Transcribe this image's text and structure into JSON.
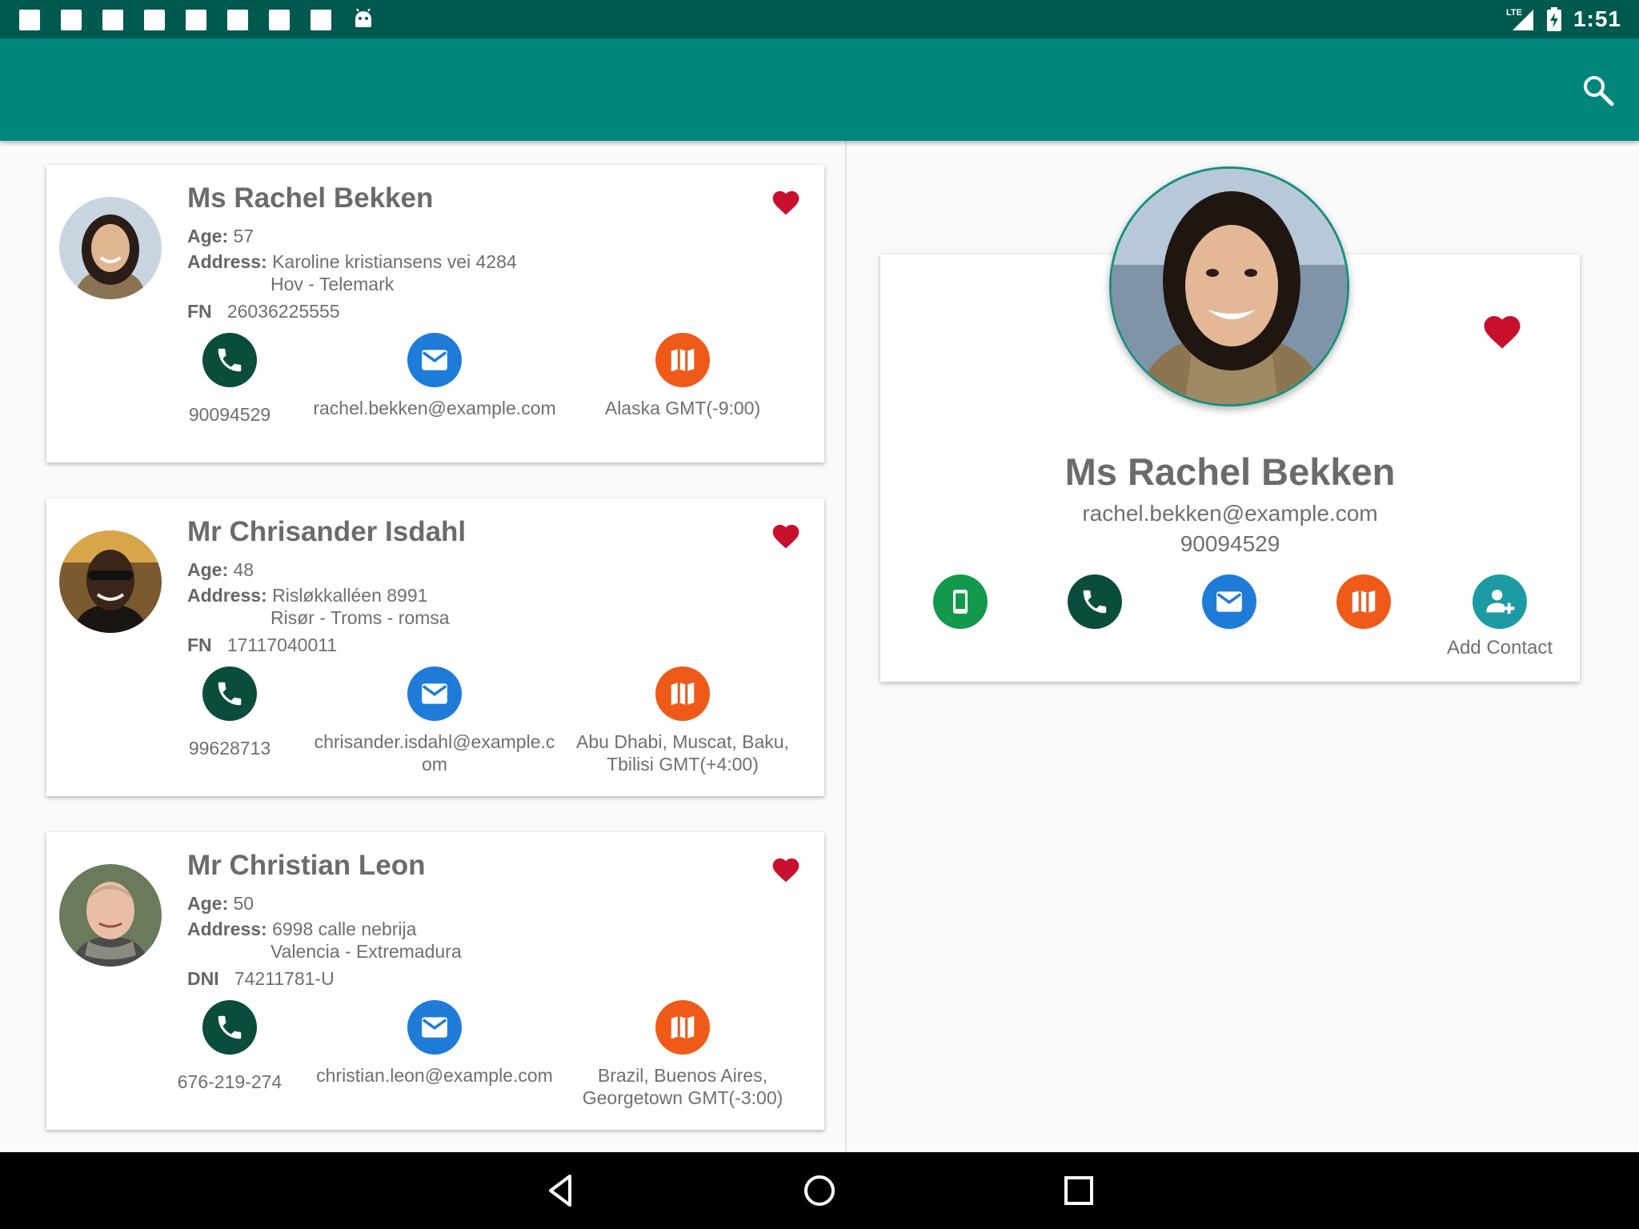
{
  "status_bar": {
    "time": "1:51",
    "network": "LTE",
    "notification_icons": [
      "square-notification-icon",
      "square-notification-icon",
      "square-notification-icon",
      "square-notification-icon",
      "square-notification-icon",
      "square-notification-icon",
      "square-notification-icon",
      "square-notification-icon",
      "android-icon"
    ]
  },
  "app_bar": {
    "color": "#00867a",
    "search_icon": "search-icon"
  },
  "contacts": [
    {
      "name": "Ms Rachel Bekken",
      "age_label": "Age:",
      "age": "57",
      "address_label": "Address:",
      "address_line1": "Karoline kristiansens vei 4284",
      "address_line2": "Hov - Telemark",
      "id_label": "FN",
      "id_value": "26036225555",
      "phone": "90094529",
      "email": "rachel.bekken@example.com",
      "timezone": "Alaska GMT(-9:00)",
      "favorite": true
    },
    {
      "name": "Mr Chrisander Isdahl",
      "age_label": "Age:",
      "age": "48",
      "address_label": "Address:",
      "address_line1": "Risløkkalléen 8991",
      "address_line2": "Risør - Troms - romsa",
      "id_label": "FN",
      "id_value": "17117040011",
      "phone": "99628713",
      "email": "chrisander.isdahl@example.com",
      "timezone": "Abu Dhabi, Muscat, Baku, Tbilisi GMT(+4:00)",
      "favorite": true
    },
    {
      "name": "Mr Christian Leon",
      "age_label": "Age:",
      "age": "50",
      "address_label": "Address:",
      "address_line1": "6998 calle nebrija",
      "address_line2": "Valencia - Extremadura",
      "id_label": "DNI",
      "id_value": "74211781-U",
      "phone": "676-219-274",
      "email": "christian.leon@example.com",
      "timezone": "Brazil, Buenos Aires, Georgetown GMT(-3:00)",
      "favorite": true
    }
  ],
  "detail": {
    "name": "Ms Rachel Bekken",
    "email": "rachel.bekken@example.com",
    "phone": "90094529",
    "favorite": true,
    "actions": [
      {
        "icon": "mobile-icon",
        "label": ""
      },
      {
        "icon": "phone-icon",
        "label": ""
      },
      {
        "icon": "email-icon",
        "label": ""
      },
      {
        "icon": "map-icon",
        "label": ""
      },
      {
        "icon": "add-contact-icon",
        "label": "Add Contact"
      }
    ]
  },
  "colors": {
    "status_bar": "#00594f",
    "app_bar": "#00867a",
    "phone": "#0a4d3c",
    "email": "#1e7cd8",
    "map": "#ef5a19",
    "mobile": "#12994b",
    "add_contact": "#1c9ba4",
    "favorite": "#c8102e"
  },
  "nav_bar": {
    "buttons": [
      "back-icon",
      "home-icon",
      "recents-icon"
    ]
  }
}
